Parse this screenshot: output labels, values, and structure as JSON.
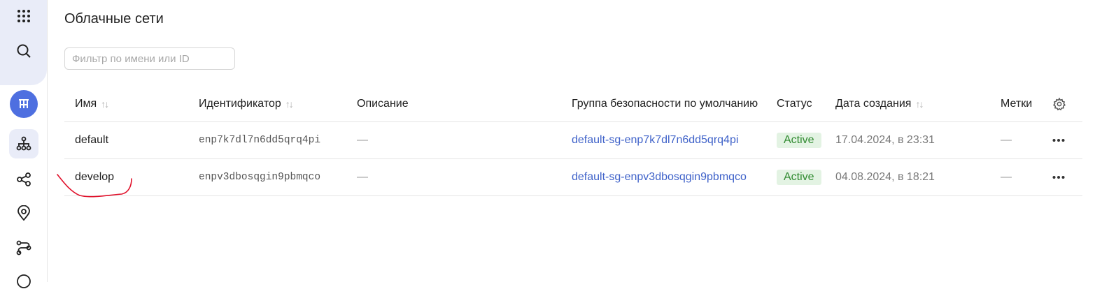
{
  "page": {
    "title": "Облачные сети"
  },
  "filter": {
    "placeholder": "Фильтр по имени или ID",
    "value": ""
  },
  "table": {
    "columns": {
      "name": "Имя",
      "id": "Идентификатор",
      "description": "Описание",
      "security_group": "Группа безопасности по умолчанию",
      "status": "Статус",
      "created": "Дата создания",
      "labels": "Метки"
    },
    "sort_glyph": "↑↓",
    "rows": [
      {
        "name": "default",
        "id": "enp7k7dl7n6dd5qrq4pi",
        "description": "—",
        "security_group": "default-sg-enp7k7dl7n6dd5qrq4pi",
        "status": "Active",
        "created": "17.04.2024, в 23:31",
        "labels": "—"
      },
      {
        "name": "develop",
        "id": "enpv3dbosqgin9pbmqco",
        "description": "—",
        "security_group": "default-sg-enpv3dbosqgin9pbmqco",
        "status": "Active",
        "created": "04.08.2024, в 18:21",
        "labels": "—"
      }
    ]
  },
  "sidebar": {
    "icons": [
      "apps-grid-icon",
      "search-icon",
      "vpc-service-icon",
      "network-topology-icon",
      "share-icon",
      "location-pin-icon",
      "route-icon"
    ]
  },
  "colors": {
    "accent": "#4e6fe0",
    "link": "#3f62c9",
    "status_active_bg": "#e3f3e3",
    "status_active_text": "#2f8a2f",
    "annotation": "#e0102a"
  }
}
